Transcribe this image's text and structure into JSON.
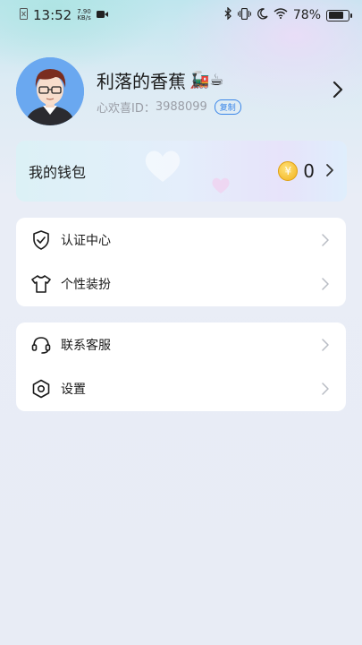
{
  "status_bar": {
    "time": "13:52",
    "net_speed_value": "7.90",
    "net_speed_unit": "KB/s",
    "battery_percent": "78%",
    "battery_level": 0.78,
    "icons": [
      "sim-icon",
      "video-icon",
      "bluetooth-icon",
      "vibrate-icon",
      "moon-icon",
      "wifi-icon",
      "battery-icon"
    ]
  },
  "profile": {
    "nickname": "利落的香蕉",
    "nickname_emoji": "🚂☕",
    "id_label": "心欢喜ID：",
    "id_value": "3988099",
    "copy_label": "复制"
  },
  "wallet": {
    "label": "我的钱包",
    "balance": "0",
    "coin_symbol": "¥"
  },
  "menu_group_1": [
    {
      "label": "认证中心",
      "icon": "shield-check-icon"
    },
    {
      "label": "个性装扮",
      "icon": "tshirt-icon"
    }
  ],
  "menu_group_2": [
    {
      "label": "联系客服",
      "icon": "headset-icon"
    },
    {
      "label": "设置",
      "icon": "settings-icon"
    }
  ],
  "colors": {
    "accent_blue": "#3a86e8",
    "coin_gold": "#f2b21a",
    "card_bg": "#ffffff",
    "page_bg": "#e8ecf5"
  }
}
